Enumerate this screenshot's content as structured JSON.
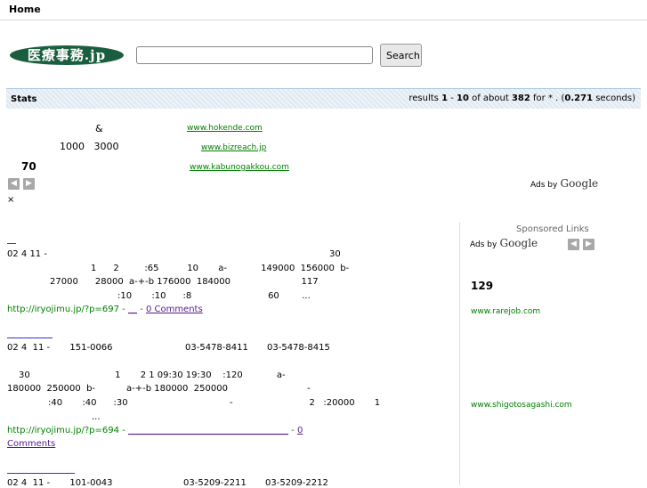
{
  "nav": {
    "home": "Home"
  },
  "logo": {
    "text": "医療事務.jp"
  },
  "search": {
    "value": "",
    "placeholder": "",
    "button": "Search"
  },
  "stats": {
    "label": "Stats",
    "results_prefix": "results ",
    "range_start": "1",
    "range_sep": " - ",
    "range_end": "10",
    "about": " of about ",
    "total": "382",
    "query": " for * . (",
    "time": "0.271",
    "suffix": " seconds)"
  },
  "ads_top": [
    {
      "text": "&",
      "link": "www.hokende.com"
    },
    {
      "text": "1000   3000",
      "link": "www.bizreach.jp"
    },
    {
      "text": "70",
      "link": "www.kabunogakkou.com"
    }
  ],
  "ads_google": {
    "ads_by": "Ads by",
    "google": "Google"
  },
  "misc_glyph": "×",
  "posts": [
    {
      "date": "02 4  11 -",
      "num": "30",
      "line2": "1      2         :65          10       a-            149000  156000  b-",
      "line3": "27000      28000  a-+-b 176000  184000                         117",
      "line4": ":10       :10      :8                           60        ...",
      "url": "http://iryojimu.jp/?p=697 - ",
      "link": "__",
      "dash": " - ",
      "comments": "0 Comments"
    },
    {
      "date": "02 4  11 -       151-0066",
      "phone1": "03-5478-8411",
      "phone2": "03-5478-8415",
      "line2": "30                              1       2 1 09:30 19:30    :120            a-",
      "line3": "180000  250000  b-           a-+-b 180000  250000                            -",
      "line4": ":40       :40      :30                                    -                           2   :20000       1",
      "line5": "...",
      "url": "http://iryojimu.jp/?p=694 - ",
      "link": "____________________________________",
      "dash": " - ",
      "comments_a": "0",
      "comments_b": "Comments"
    },
    {
      "date": "02 4  11 -       101-0043",
      "phone1": "03-5209-2211",
      "phone2": "03-5209-2212"
    }
  ],
  "sidebar": {
    "sponsored": "Sponsored Links",
    "ads_by": "Ads by",
    "google": "Google",
    "num": "129",
    "link1": "www.rarejob.com",
    "link2": "www.shigotosagashi.com"
  }
}
